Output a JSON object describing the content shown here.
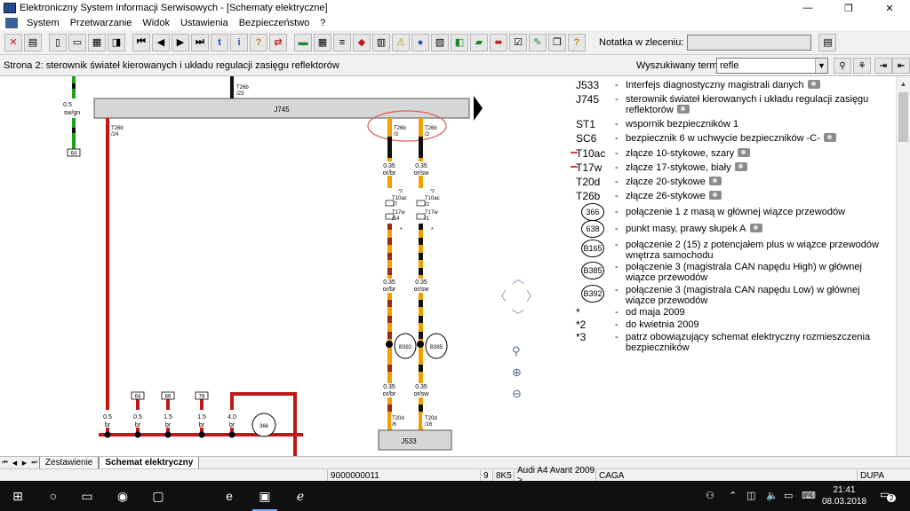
{
  "window": {
    "title": "Elektroniczny System Informacji Serwisowych - [Schematy elektryczne]",
    "controls": {
      "minimize": "—",
      "maximize": "❐",
      "close": "✕"
    }
  },
  "menu": [
    "System",
    "Przetwarzanie",
    "Widok",
    "Ustawienia",
    "Bezpieczeństwo",
    "?"
  ],
  "toolbar": {
    "notatka_label": "Notatka w zleceniu:",
    "notatka_value": ""
  },
  "infobar": {
    "page_title": "Strona 2: sterownik świateł kierowanych i układu regulacji zasięgu reflektorów",
    "search_label": "Wyszukiwany termin:",
    "search_value": "refle"
  },
  "schema": {
    "module_top": "J745",
    "module_bottom": "J533",
    "wires": {
      "left_top": {
        "gauge": "0.5",
        "color": "sw/gn",
        "ref": "64"
      },
      "center_top_pin": "T26b",
      "center_top_num": "/23",
      "left_red_pin": "T26b",
      "left_red_num": "/24",
      "pin_a": "T26b",
      "pin_a_num": "/3",
      "pin_b": "T26b",
      "pin_b_num": "/2",
      "w1a": {
        "gauge": "0.35",
        "color": "or/br"
      },
      "w1b": {
        "gauge": "0.35",
        "color": "or/sw"
      },
      "t10a": "T10ac",
      "t10a_num": "/7",
      "t10a_sup": "*2",
      "t10b": "T10ac",
      "t10b_num": "/2",
      "t10b_sup": "*2",
      "t17a": "T17w",
      "t17a_num": "/14",
      "t17b": "T17w",
      "t17b_num": "/1",
      "star": "*",
      "w2a": {
        "gauge": "0.35",
        "color": "or/br"
      },
      "w2b": {
        "gauge": "0.35",
        "color": "or/sw"
      },
      "splice_a": "B392",
      "splice_b": "B385",
      "w3a": {
        "gauge": "0.35",
        "color": "or/br"
      },
      "w3b": {
        "gauge": "0.35",
        "color": "or/sw"
      },
      "t20a": "T20d",
      "t20a_num": "/6",
      "t20b": "T20d",
      "t20b_num": "/16",
      "bottom_wires": [
        {
          "ref": "64",
          "gauge": "0.5",
          "color": "br"
        },
        {
          "ref": "66",
          "gauge": "0.5",
          "color": "br"
        },
        {
          "ref": "66",
          "gauge": "1.5",
          "color": "br"
        },
        {
          "ref": "78",
          "gauge": "1.5",
          "color": "br"
        },
        {
          "ref": "",
          "gauge": "4.0",
          "color": "br"
        }
      ],
      "ground_circle": "366"
    }
  },
  "legend": [
    {
      "code": "J533",
      "desc": "Interfejs diagnostyczny magistrali danych",
      "cam": true
    },
    {
      "code": "J745",
      "desc": "sterownik świateł kierowanych i układu regulacji zasięgu reflektorów",
      "cam": true
    },
    {
      "code": "ST1",
      "desc": "wspornik bezpieczników 1",
      "cam": false
    },
    {
      "code": "SC6",
      "desc": "bezpiecznik 6 w uchwycie bezpieczników -C-",
      "cam": true
    },
    {
      "code": "T10ac",
      "desc": "złącze 10-stykowe, szary",
      "cam": true
    },
    {
      "code": "T17w",
      "desc": "złącze 17-stykowe, biały",
      "cam": true
    },
    {
      "code": "T20d",
      "desc": "złącze 20-stykowe",
      "cam": true
    },
    {
      "code": "T26b",
      "desc": "złącze 26-stykowe",
      "cam": true
    },
    {
      "code": "366",
      "desc": "połączenie 1 z masą w głównej wiązce przewodów",
      "cam": false
    },
    {
      "code": "638",
      "desc": "punkt masy, prawy słupek A",
      "cam": true
    },
    {
      "code": "B165",
      "desc": "połączenie 2 (15) z potencjałem plus w wiązce przewodów wnętrza samochodu",
      "cam": false
    },
    {
      "code": "B385",
      "desc": "połączenie 3 (magistrala CAN napędu High) w głównej wiązce przewodów",
      "cam": false
    },
    {
      "code": "B392",
      "desc": "połączenie 3 (magistrala CAN napędu Low) w głównej wiązce przewodów",
      "cam": false
    },
    {
      "code": "*",
      "desc": "od maja 2009",
      "cam": false
    },
    {
      "code": "*2",
      "desc": "do kwietnia 2009",
      "cam": false
    },
    {
      "code": "*3",
      "desc": "patrz obowiązujący schemat elektryczny rozmieszczenia bezpieczników",
      "cam": false
    }
  ],
  "tabs": [
    "Zestawienie",
    "Schemat elektryczny"
  ],
  "status": [
    "9000000011",
    "9",
    "8K5",
    "Audi A4 Avant 2009 >",
    "CAGA",
    "DUPA"
  ],
  "taskbar": {
    "time": "21:41",
    "date": "08.03.2018",
    "notifications": "2"
  },
  "colors": {
    "wire_red": "#c01818",
    "wire_orange": "#f0a000",
    "wire_black": "#111111",
    "wire_green": "#1fa01f",
    "annotation": "#e05858"
  }
}
